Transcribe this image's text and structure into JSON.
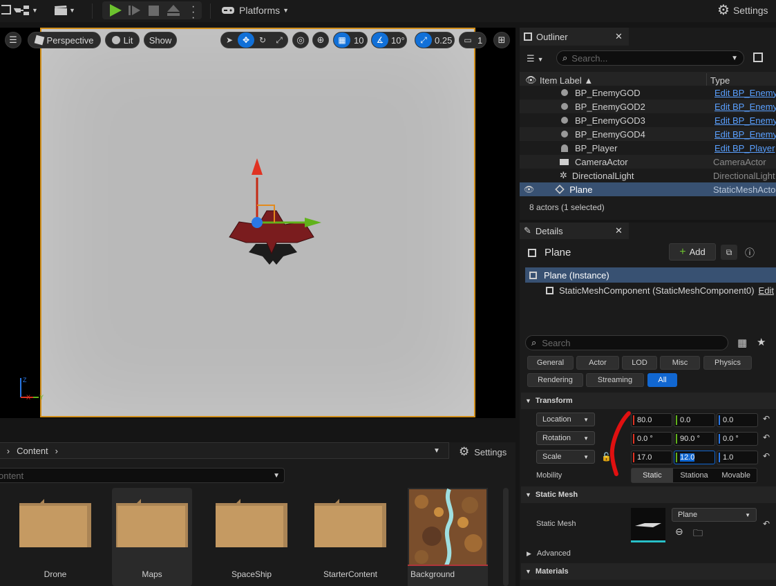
{
  "toolbar": {
    "platforms_label": "Platforms",
    "settings_label": "Settings"
  },
  "viewport": {
    "view_mode": "Perspective",
    "lighting_mode": "Lit",
    "show_label": "Show",
    "grid_snap": "10",
    "rotation_snap": "10°",
    "scale_snap": "0.25",
    "camera_speed": "1"
  },
  "content_browser": {
    "breadcrumb_all": "ll",
    "breadcrumb_content": "Content",
    "settings_label": "Settings",
    "search_placeholder": "ontent",
    "items": [
      {
        "label": "Drone"
      },
      {
        "label": "Maps"
      },
      {
        "label": "SpaceShip"
      },
      {
        "label": "StarterContent"
      },
      {
        "label": "Background"
      }
    ]
  },
  "outliner": {
    "tab_label": "Outliner",
    "search_placeholder": "Search...",
    "col_label": "Item Label ▲",
    "col_type": "Type",
    "rows": [
      {
        "label": "BP_EnemyGOD",
        "type": "Edit BP_EnemyG"
      },
      {
        "label": "BP_EnemyGOD2",
        "type": "Edit BP_EnemyG"
      },
      {
        "label": "BP_EnemyGOD3",
        "type": "Edit BP_EnemyG"
      },
      {
        "label": "BP_EnemyGOD4",
        "type": "Edit BP_EnemyG"
      },
      {
        "label": "BP_Player",
        "type": "Edit BP_Player"
      },
      {
        "label": "CameraActor",
        "type": "CameraActor"
      },
      {
        "label": "DirectionalLight",
        "type": "DirectionalLight"
      },
      {
        "label": "Plane",
        "type": "StaticMeshActor"
      }
    ],
    "status": "8 actors (1 selected)"
  },
  "details": {
    "tab_label": "Details",
    "actor_name": "Plane",
    "add_label": "Add",
    "instance_label": "Plane (Instance)",
    "component_label": "StaticMeshComponent (StaticMeshComponent0)",
    "component_edit": "Edit",
    "search_placeholder": "Search",
    "categories": [
      "General",
      "Actor",
      "LOD",
      "Misc",
      "Physics",
      "Rendering",
      "Streaming",
      "All"
    ],
    "transform_section": "Transform",
    "location_label": "Location",
    "rotation_label": "Rotation",
    "scale_label": "Scale",
    "mobility_label": "Mobility",
    "location": [
      "80.0",
      "0.0",
      "0.0"
    ],
    "rotation": [
      "0.0 °",
      "90.0 °",
      "0.0 °"
    ],
    "scale": [
      "17.0",
      "12.0",
      "1.0"
    ],
    "mobility_options": [
      "Static",
      "Stationa",
      "Movable"
    ],
    "static_mesh_section": "Static Mesh",
    "static_mesh_label": "Static Mesh",
    "static_mesh_value": "Plane",
    "advanced_label": "Advanced",
    "materials_section": "Materials"
  },
  "colors": {
    "accent": "#1167d1",
    "selection_border": "#d28f19",
    "x_axis": "#e03222",
    "y_axis": "#61b21b",
    "z_axis": "#2a78e6",
    "annotation": "#e01010"
  }
}
